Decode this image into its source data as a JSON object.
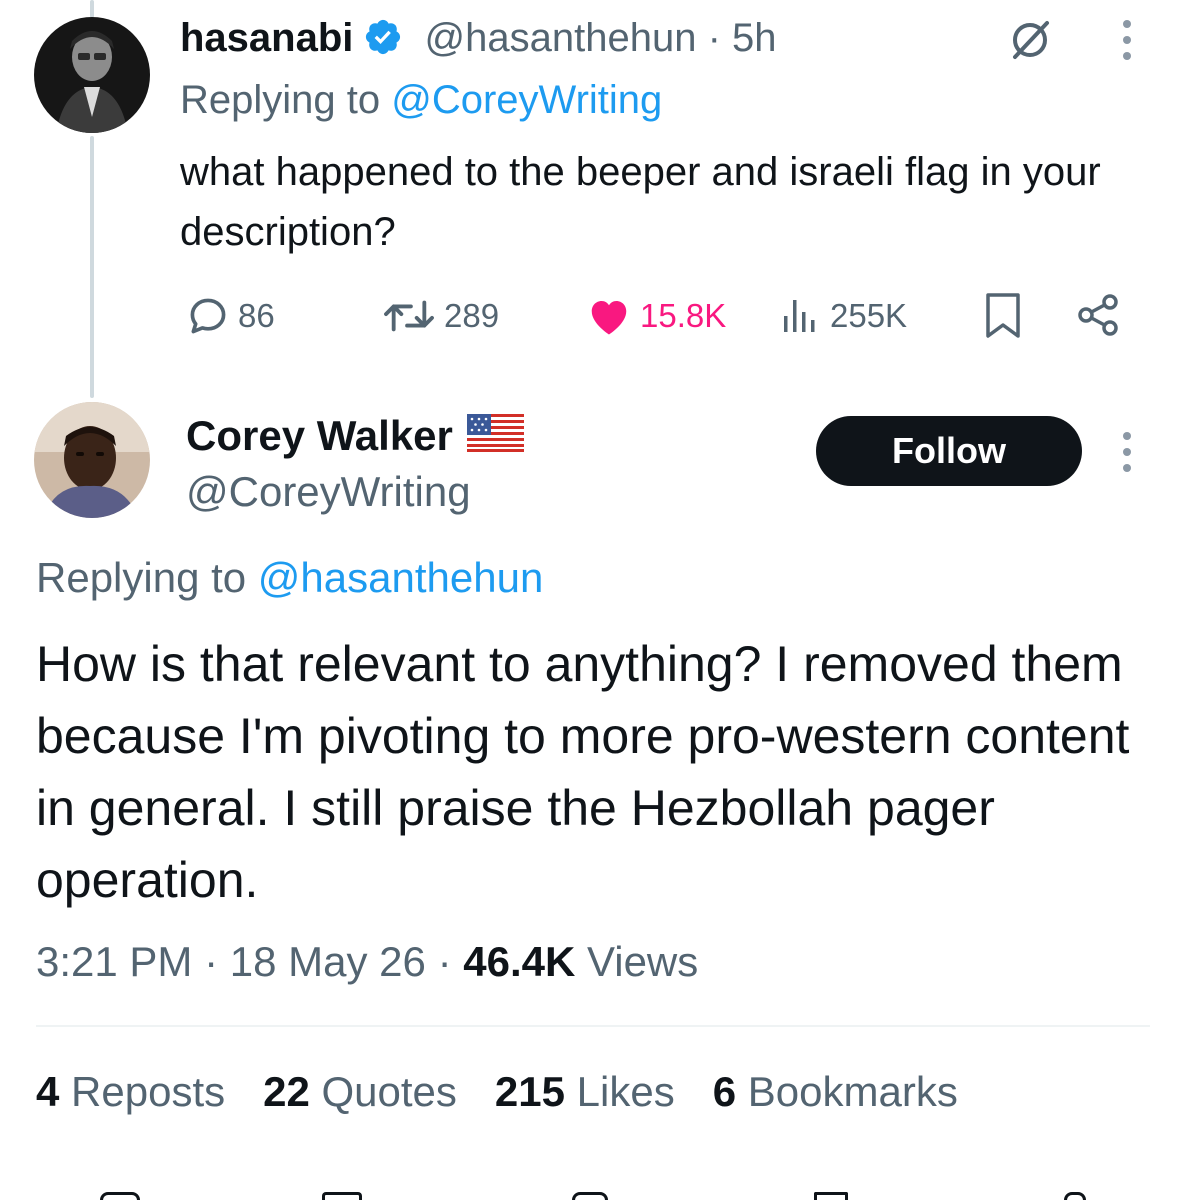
{
  "reply": {
    "display_name": "hasanabi",
    "handle": "@hasanthehun",
    "separator": "·",
    "time_ago": "5h",
    "replying_prefix": "Replying to",
    "replying_handle": "@CoreyWriting",
    "text": "what happened to the beeper and israeli flag in your description?",
    "actions": {
      "replies": "86",
      "reposts": "289",
      "likes": "15.8K",
      "views": "255K"
    }
  },
  "main": {
    "display_name": "Corey Walker",
    "handle": "@CoreyWriting",
    "follow_label": "Follow",
    "replying_prefix": "Replying to",
    "replying_handle": "@hasanthehun",
    "text": "How is that relevant to anything? I removed them because I'm pivoting to more pro-western content in general. I still praise the Hezbollah pager operation.",
    "time": "3:21 PM",
    "date": "18 May 26",
    "separator": "·",
    "views_count": "46.4K",
    "views_label": "Views"
  },
  "stats": {
    "reposts_count": "4",
    "reposts_label": "Reposts",
    "quotes_count": "22",
    "quotes_label": "Quotes",
    "likes_count": "215",
    "likes_label": "Likes",
    "bookmarks_count": "6",
    "bookmarks_label": "Bookmarks"
  },
  "colors": {
    "link": "#1d9bf0",
    "like": "#f91880",
    "muted": "#536471",
    "text": "#0f1419",
    "verified": "#1d9bf0"
  },
  "icons": [
    "grok-icon",
    "more-icon",
    "verified-icon",
    "reply-icon",
    "repost-icon",
    "like-icon",
    "views-icon",
    "bookmark-icon",
    "share-icon",
    "us-flag-icon"
  ]
}
